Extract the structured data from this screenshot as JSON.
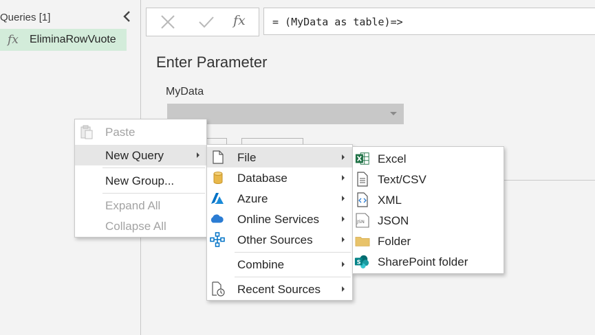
{
  "queries_pane": {
    "header": "Queries [1]",
    "items": [
      {
        "fx": "fx",
        "name": "EliminaRowVuote"
      }
    ]
  },
  "formula_bar": {
    "fx_label": "fx",
    "formula": "= (MyData as table)=>"
  },
  "parameter": {
    "title": "Enter Parameter",
    "label": "MyData",
    "value": ""
  },
  "context_menu": {
    "items": [
      {
        "label": "Paste",
        "enabled": false,
        "icon": "clipboard-icon"
      },
      {
        "label": "New Query",
        "enabled": true,
        "highlighted": true,
        "submenu": true
      },
      {
        "label": "New Group...",
        "enabled": true
      },
      {
        "label": "Expand All",
        "enabled": false
      },
      {
        "label": "Collapse All",
        "enabled": false
      }
    ]
  },
  "new_query_menu": {
    "items": [
      {
        "label": "File",
        "icon": "file-icon",
        "submenu": true,
        "highlighted": true
      },
      {
        "label": "Database",
        "icon": "database-icon",
        "submenu": true
      },
      {
        "label": "Azure",
        "icon": "azure-icon",
        "submenu": true
      },
      {
        "label": "Online Services",
        "icon": "cloud-icon",
        "submenu": true
      },
      {
        "label": "Other Sources",
        "icon": "other-sources-icon",
        "submenu": true
      },
      {
        "label": "Combine",
        "submenu": true
      },
      {
        "label": "Recent Sources",
        "icon": "recent-sources-icon",
        "submenu": true
      }
    ]
  },
  "file_menu": {
    "items": [
      {
        "label": "Excel",
        "icon": "excel-icon"
      },
      {
        "label": "Text/CSV",
        "icon": "text-csv-icon"
      },
      {
        "label": "XML",
        "icon": "xml-icon"
      },
      {
        "label": "JSON",
        "icon": "json-icon",
        "icon_text": "JSN"
      },
      {
        "label": "Folder",
        "icon": "folder-icon"
      },
      {
        "label": "SharePoint folder",
        "icon": "sharepoint-icon",
        "icon_text": "S"
      }
    ]
  },
  "colors": {
    "query_selected_bg": "#d3ecda",
    "menu_highlight": "#e6e6e6",
    "excel_green": "#1e7145",
    "azure_blue": "#0072c6",
    "folder_yellow": "#e8c36a",
    "sharepoint_teal": "#038387",
    "database_gold": "#e8b84b"
  }
}
